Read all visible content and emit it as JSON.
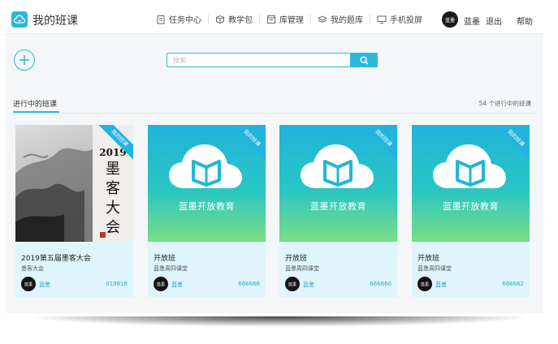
{
  "app": {
    "title": "我的班课"
  },
  "nav": {
    "items": [
      {
        "label": "任务中心",
        "icon": "clipboard-icon"
      },
      {
        "label": "教学包",
        "icon": "package-icon"
      },
      {
        "label": "库管理",
        "icon": "library-icon"
      },
      {
        "label": "我的题库",
        "icon": "layers-icon"
      },
      {
        "label": "手机投屏",
        "icon": "screen-cast-icon"
      }
    ],
    "user_avatar_text": "蓝墨",
    "user_name": "蓝墨",
    "logout": "退出",
    "help": "帮助"
  },
  "search": {
    "placeholder": "搜索"
  },
  "section": {
    "title": "进行中的班课",
    "count": "54 个进行中的班课"
  },
  "cards": [
    {
      "title": "2019第五届墨客大会",
      "subtitle": "墨客大会",
      "author": "蓝墨",
      "code": "019818",
      "ribbon": "我的班课",
      "cover": "ink",
      "cover_text": "2019墨客大会",
      "avatar_text": "蓝墨"
    },
    {
      "title": "开放班",
      "subtitle": "蓝墨周四课堂",
      "author": "蓝墨",
      "code": "666666",
      "ribbon": "我的班课",
      "cover": "teal",
      "cover_text": "蓝墨开放教育",
      "avatar_text": "蓝墨"
    },
    {
      "title": "开放班",
      "subtitle": "蓝墨周四课堂",
      "author": "蓝墨",
      "code": "666660",
      "ribbon": "我的班课",
      "cover": "teal",
      "cover_text": "蓝墨开放教育",
      "avatar_text": "蓝墨"
    },
    {
      "title": "开放班",
      "subtitle": "蓝墨周四课堂",
      "author": "蓝墨",
      "code": "666662",
      "ribbon": "我的班课",
      "cover": "teal",
      "cover_text": "蓝墨开放教育",
      "avatar_text": "蓝墨"
    }
  ],
  "colors": {
    "accent": "#2db7de",
    "card_bg": "#dff5fb",
    "page_bg": "#f4f6f8"
  }
}
